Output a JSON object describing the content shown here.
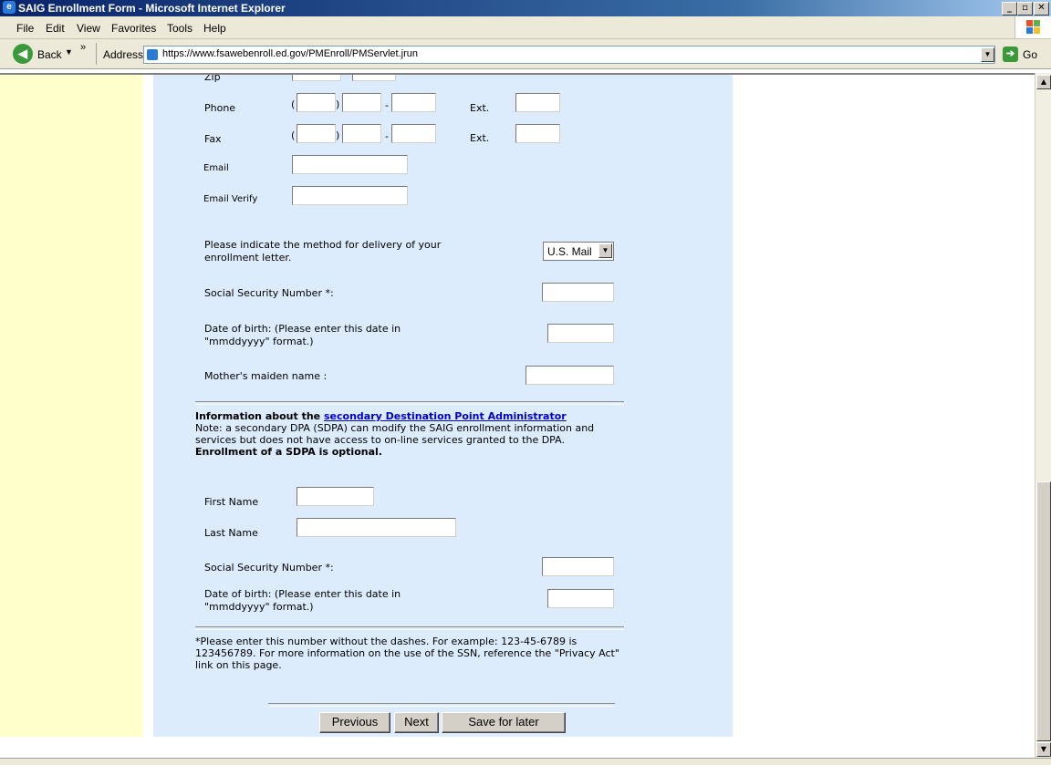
{
  "window": {
    "title": "SAIG Enrollment Form - Microsoft Internet Explorer"
  },
  "menu": [
    "File",
    "Edit",
    "View",
    "Favorites",
    "Tools",
    "Help"
  ],
  "toolbar": {
    "back_label": "Back",
    "address_label": "Address",
    "url": "https://www.fsawebenroll.ed.gov/PMEnroll/PMServlet.jrun",
    "go_label": "Go"
  },
  "form": {
    "zip_label": "Zip",
    "phone_label": "Phone",
    "fax_label": "Fax",
    "ext_label": "Ext.",
    "paren_open": "(",
    "paren_close": ")",
    "dash": "-",
    "email_label": "Email",
    "email_verify_label": "Email Verify",
    "delivery_label": "Please indicate the method for delivery of your enrollment letter.",
    "delivery_value": "U.S. Mail",
    "ssn_label": "Social Security Number *:",
    "dob_label": "Date of birth: (Please enter this date in \"mmddyyyy\" format.)",
    "maiden_label": "Mother's maiden name :"
  },
  "secondary": {
    "heading_prefix": "Information about the ",
    "heading_link": "secondary Destination Point Administrator",
    "note": "Note: a secondary DPA (SDPA) can modify the SAIG enrollment information and services but does not have access to on-line services granted to the DPA.",
    "optional": "Enrollment of a SDPA is optional.",
    "first_name_label": "First Name",
    "last_name_label": "Last Name",
    "ssn_label": "Social Security Number *:",
    "dob_label": "Date of birth: (Please enter this date in \"mmddyyyy\" format.)"
  },
  "footnote": "*Please enter this number without the dashes. For example: 123-45-6789 is 123456789. For more information on the use of the SSN, reference the \"Privacy Act\" link on this page.",
  "buttons": {
    "previous": "Previous",
    "next": "Next",
    "save": "Save for later"
  }
}
